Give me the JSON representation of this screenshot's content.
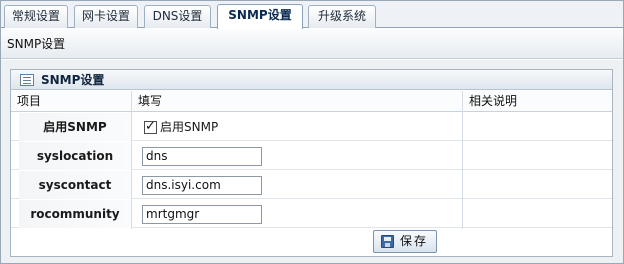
{
  "tabs": [
    {
      "label": "常规设置",
      "active": false
    },
    {
      "label": "网卡设置",
      "active": false
    },
    {
      "label": "DNS设置",
      "active": false
    },
    {
      "label": "SNMP设置",
      "active": true
    },
    {
      "label": "升级系统",
      "active": false
    }
  ],
  "page_title": "SNMP设置",
  "panel": {
    "title": "SNMP设置",
    "icon": "table-icon",
    "columns": {
      "item": "项目",
      "value": "填写",
      "description": "相关说明"
    },
    "rows": [
      {
        "label": "启用SNMP",
        "type": "checkbox",
        "checked": true,
        "checkbox_label": "启用SNMP",
        "mark": "✓"
      },
      {
        "label": "syslocation",
        "type": "text",
        "value": "dns"
      },
      {
        "label": "syscontact",
        "type": "text",
        "value": "dns.isyi.com"
      },
      {
        "label": "rocommunity",
        "type": "text",
        "value": "mrtgmgr"
      }
    ]
  },
  "save_button": {
    "label": "保存",
    "icon": "save-icon"
  }
}
